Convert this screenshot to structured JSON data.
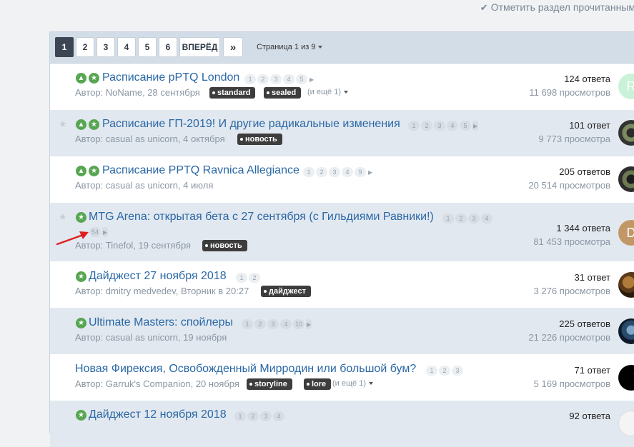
{
  "mark_read": {
    "label": "Отметить раздел прочитанным"
  },
  "pagination": {
    "pages": [
      "1",
      "2",
      "3",
      "4",
      "5",
      "6"
    ],
    "next_label": "ВПЕРЁД",
    "last_label": "»",
    "page_info": "Страница 1 из 9"
  },
  "topics": [
    {
      "title": "Расписание pPTQ London",
      "pages": [
        "1",
        "2",
        "3",
        "4",
        "5"
      ],
      "author": "Автор: NoName, 28 сентября",
      "tags": [
        "standard",
        "sealed"
      ],
      "extra_tags": "(и ещё 1)",
      "replies": "124 ответа",
      "views": "11 698 просмотров"
    },
    {
      "title": "Расписание ГП-2019! И другие радикальные изменения",
      "pages": [
        "1",
        "2",
        "3",
        "4",
        "5"
      ],
      "author": "Автор: casual as unicorn, 4 октября",
      "tags": [
        "новость"
      ],
      "replies": "101 ответ",
      "views": "9 773 просмотра"
    },
    {
      "title": "Расписание PPTQ Ravnica Allegiance",
      "pages": [
        "1",
        "2",
        "3",
        "4",
        "9"
      ],
      "author": "Автор: casual as unicorn, 4 июля",
      "tags": [],
      "replies": "205 ответов",
      "views": "20 514 просмотров"
    },
    {
      "title": "MTG Arena: открытая бета с 27 сентября (с Гильдиями Равники!)",
      "pages": [
        "1",
        "2",
        "3",
        "4",
        "54"
      ],
      "author": "Автор: Tinefol, 19 сентября",
      "tags": [
        "новость"
      ],
      "replies": "1 344 ответа",
      "views": "81 453 просмотра"
    },
    {
      "title": "Дайджест 27 ноября 2018",
      "pages": [
        "1",
        "2"
      ],
      "author": "Автор: dmitry medvedev, Вторник в 20:27",
      "tags": [
        "дайджест"
      ],
      "replies": "31 ответ",
      "views": "3 276 просмотров"
    },
    {
      "title": "Ultimate Masters: спойлеры",
      "pages": [
        "1",
        "2",
        "3",
        "4",
        "10"
      ],
      "author": "Автор: casual as unicorn, 19 ноября",
      "tags": [],
      "replies": "225 ответов",
      "views": "21 226 просмотров"
    },
    {
      "title": "Новая Фирексия, Освобожденный Мирродин или большой бум?",
      "pages": [
        "1",
        "2",
        "3"
      ],
      "author": "Автор: Garruk's Companion, 20 ноября",
      "tags": [
        "storyline",
        "lore"
      ],
      "extra_tags": "(и ещё 1)",
      "replies": "71 ответ",
      "views": "5 169 просмотров"
    },
    {
      "title": "Дайджест 12 ноября 2018",
      "pages": [
        "1",
        "2",
        "3",
        "4"
      ],
      "replies": "92 ответа"
    }
  ],
  "avatars": [
    "R",
    "",
    "",
    "D",
    "",
    "",
    "",
    ""
  ],
  "colors": {
    "accent": "#2a68a6",
    "badge": "#57a651",
    "toolbar": "#d3dde8",
    "alt_row": "#e2e8ef",
    "tag": "#3d3d3d",
    "arrow": "#e0201e"
  }
}
